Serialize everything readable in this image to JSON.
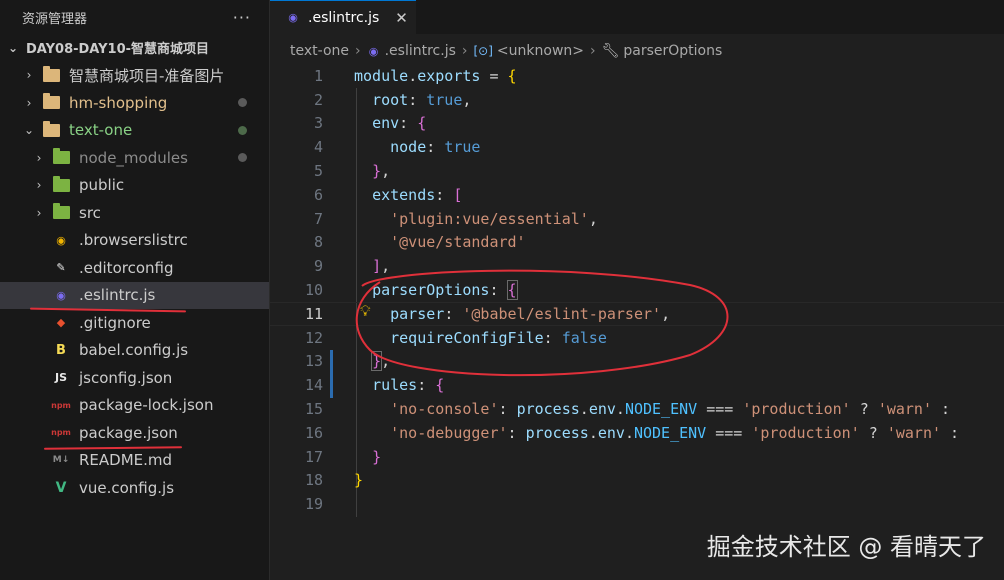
{
  "explorer": {
    "title": "资源管理器",
    "more": "···",
    "root": "DAY08-DAY10-智慧商城项目",
    "items": [
      {
        "label": "智慧商城项目-准备图片",
        "kind": "folder",
        "indent": 1
      },
      {
        "label": "hm-shopping",
        "kind": "folder",
        "indent": 1
      },
      {
        "label": "text-one",
        "kind": "folder-open",
        "indent": 1
      },
      {
        "label": "node_modules",
        "kind": "folder-node",
        "indent": 2
      },
      {
        "label": "public",
        "kind": "folder-public",
        "indent": 2
      },
      {
        "label": "src",
        "kind": "folder-src",
        "indent": 2
      },
      {
        "label": ".browserslistrc",
        "kind": "browserslist",
        "indent": 2
      },
      {
        "label": ".editorconfig",
        "kind": "editorconfig",
        "indent": 2
      },
      {
        "label": ".eslintrc.js",
        "kind": "eslint",
        "indent": 2
      },
      {
        "label": ".gitignore",
        "kind": "git",
        "indent": 2
      },
      {
        "label": "babel.config.js",
        "kind": "babel",
        "indent": 2
      },
      {
        "label": "jsconfig.json",
        "kind": "jsconfig",
        "indent": 2
      },
      {
        "label": "package-lock.json",
        "kind": "npm",
        "indent": 2
      },
      {
        "label": "package.json",
        "kind": "npm",
        "indent": 2
      },
      {
        "label": "README.md",
        "kind": "markdown",
        "indent": 2
      },
      {
        "label": "vue.config.js",
        "kind": "vue",
        "indent": 2
      }
    ]
  },
  "tab": {
    "label": ".eslintrc.js",
    "close": "✕"
  },
  "breadcrumbs": [
    "text-one",
    ".eslintrc.js",
    "<unknown>",
    "parserOptions"
  ],
  "code": {
    "line_numbers": [
      "1",
      "2",
      "3",
      "4",
      "5",
      "6",
      "7",
      "8",
      "9",
      "10",
      "11",
      "12",
      "13",
      "14",
      "15",
      "16",
      "17",
      "18",
      "19"
    ],
    "active_line": "11"
  },
  "watermark": "掘金技术社区 @ 看晴天了",
  "colors": {
    "accent": "#0078d4",
    "annotation": "#e0303a"
  }
}
